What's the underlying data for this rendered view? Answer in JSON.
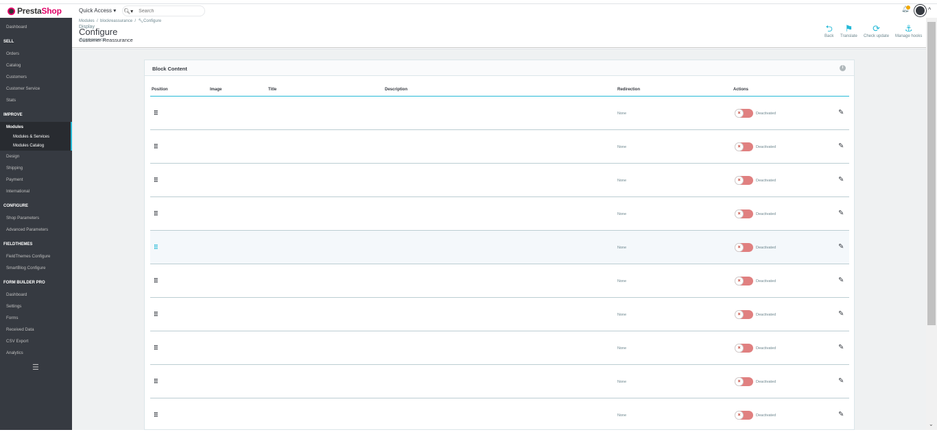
{
  "topbar": {
    "logo_a": "Presta",
    "logo_b": "Shop",
    "quick_access": "Quick Access ▾",
    "search_placeholder": "Search"
  },
  "sidebar": {
    "dashboard": "Dashboard",
    "sell": "SELL",
    "orders": "Orders",
    "catalog": "Catalog",
    "customers": "Customers",
    "customer_service": "Customer Service",
    "stats": "Stats",
    "improve": "IMPROVE",
    "modules": "Modules",
    "modules_services": "Modules & Services",
    "modules_catalog": "Modules Catalog",
    "design": "Design",
    "shipping": "Shipping",
    "payment": "Payment",
    "international": "International",
    "configure": "CONFIGURE",
    "shop_parameters": "Shop Parameters",
    "advanced_parameters": "Advanced Parameters",
    "fieldthemes": "FIELDTHEMES",
    "fieldthemes_configure": "FieldThemes Configure",
    "smartblog_configure": "SmartBlog Configure",
    "form_builder": "FORM BUILDER PRO",
    "fb_dashboard": "Dashboard",
    "fb_settings": "Settings",
    "fb_forms": "Forms",
    "fb_received": "Received Data",
    "fb_csv": "CSV Export",
    "fb_analytics": "Analytics"
  },
  "header": {
    "crumb_1": "Modules",
    "crumb_2": "blockreassurance",
    "crumb_3": "Configure",
    "display": "Display",
    "title": "Configure",
    "subtitle": "Customer Reassurance",
    "appearance": "Appearance",
    "back": "Back",
    "translate": "Translate",
    "check_update": "Check update",
    "manage_hooks": "Manage hooks"
  },
  "panel": {
    "title": "Block Content",
    "columns": {
      "position": "Position",
      "image": "Image",
      "title": "Title",
      "description": "Description",
      "redirection": "Redirection",
      "actions": "Actions"
    },
    "rows": [
      {
        "redirection": "None",
        "status": "Deactivated"
      },
      {
        "redirection": "None",
        "status": "Deactivated"
      },
      {
        "redirection": "None",
        "status": "Deactivated"
      },
      {
        "redirection": "None",
        "status": "Deactivated"
      },
      {
        "redirection": "None",
        "status": "Deactivated"
      },
      {
        "redirection": "None",
        "status": "Deactivated"
      },
      {
        "redirection": "None",
        "status": "Deactivated"
      },
      {
        "redirection": "None",
        "status": "Deactivated"
      },
      {
        "redirection": "None",
        "status": "Deactivated"
      },
      {
        "redirection": "None",
        "status": "Deactivated"
      }
    ]
  }
}
